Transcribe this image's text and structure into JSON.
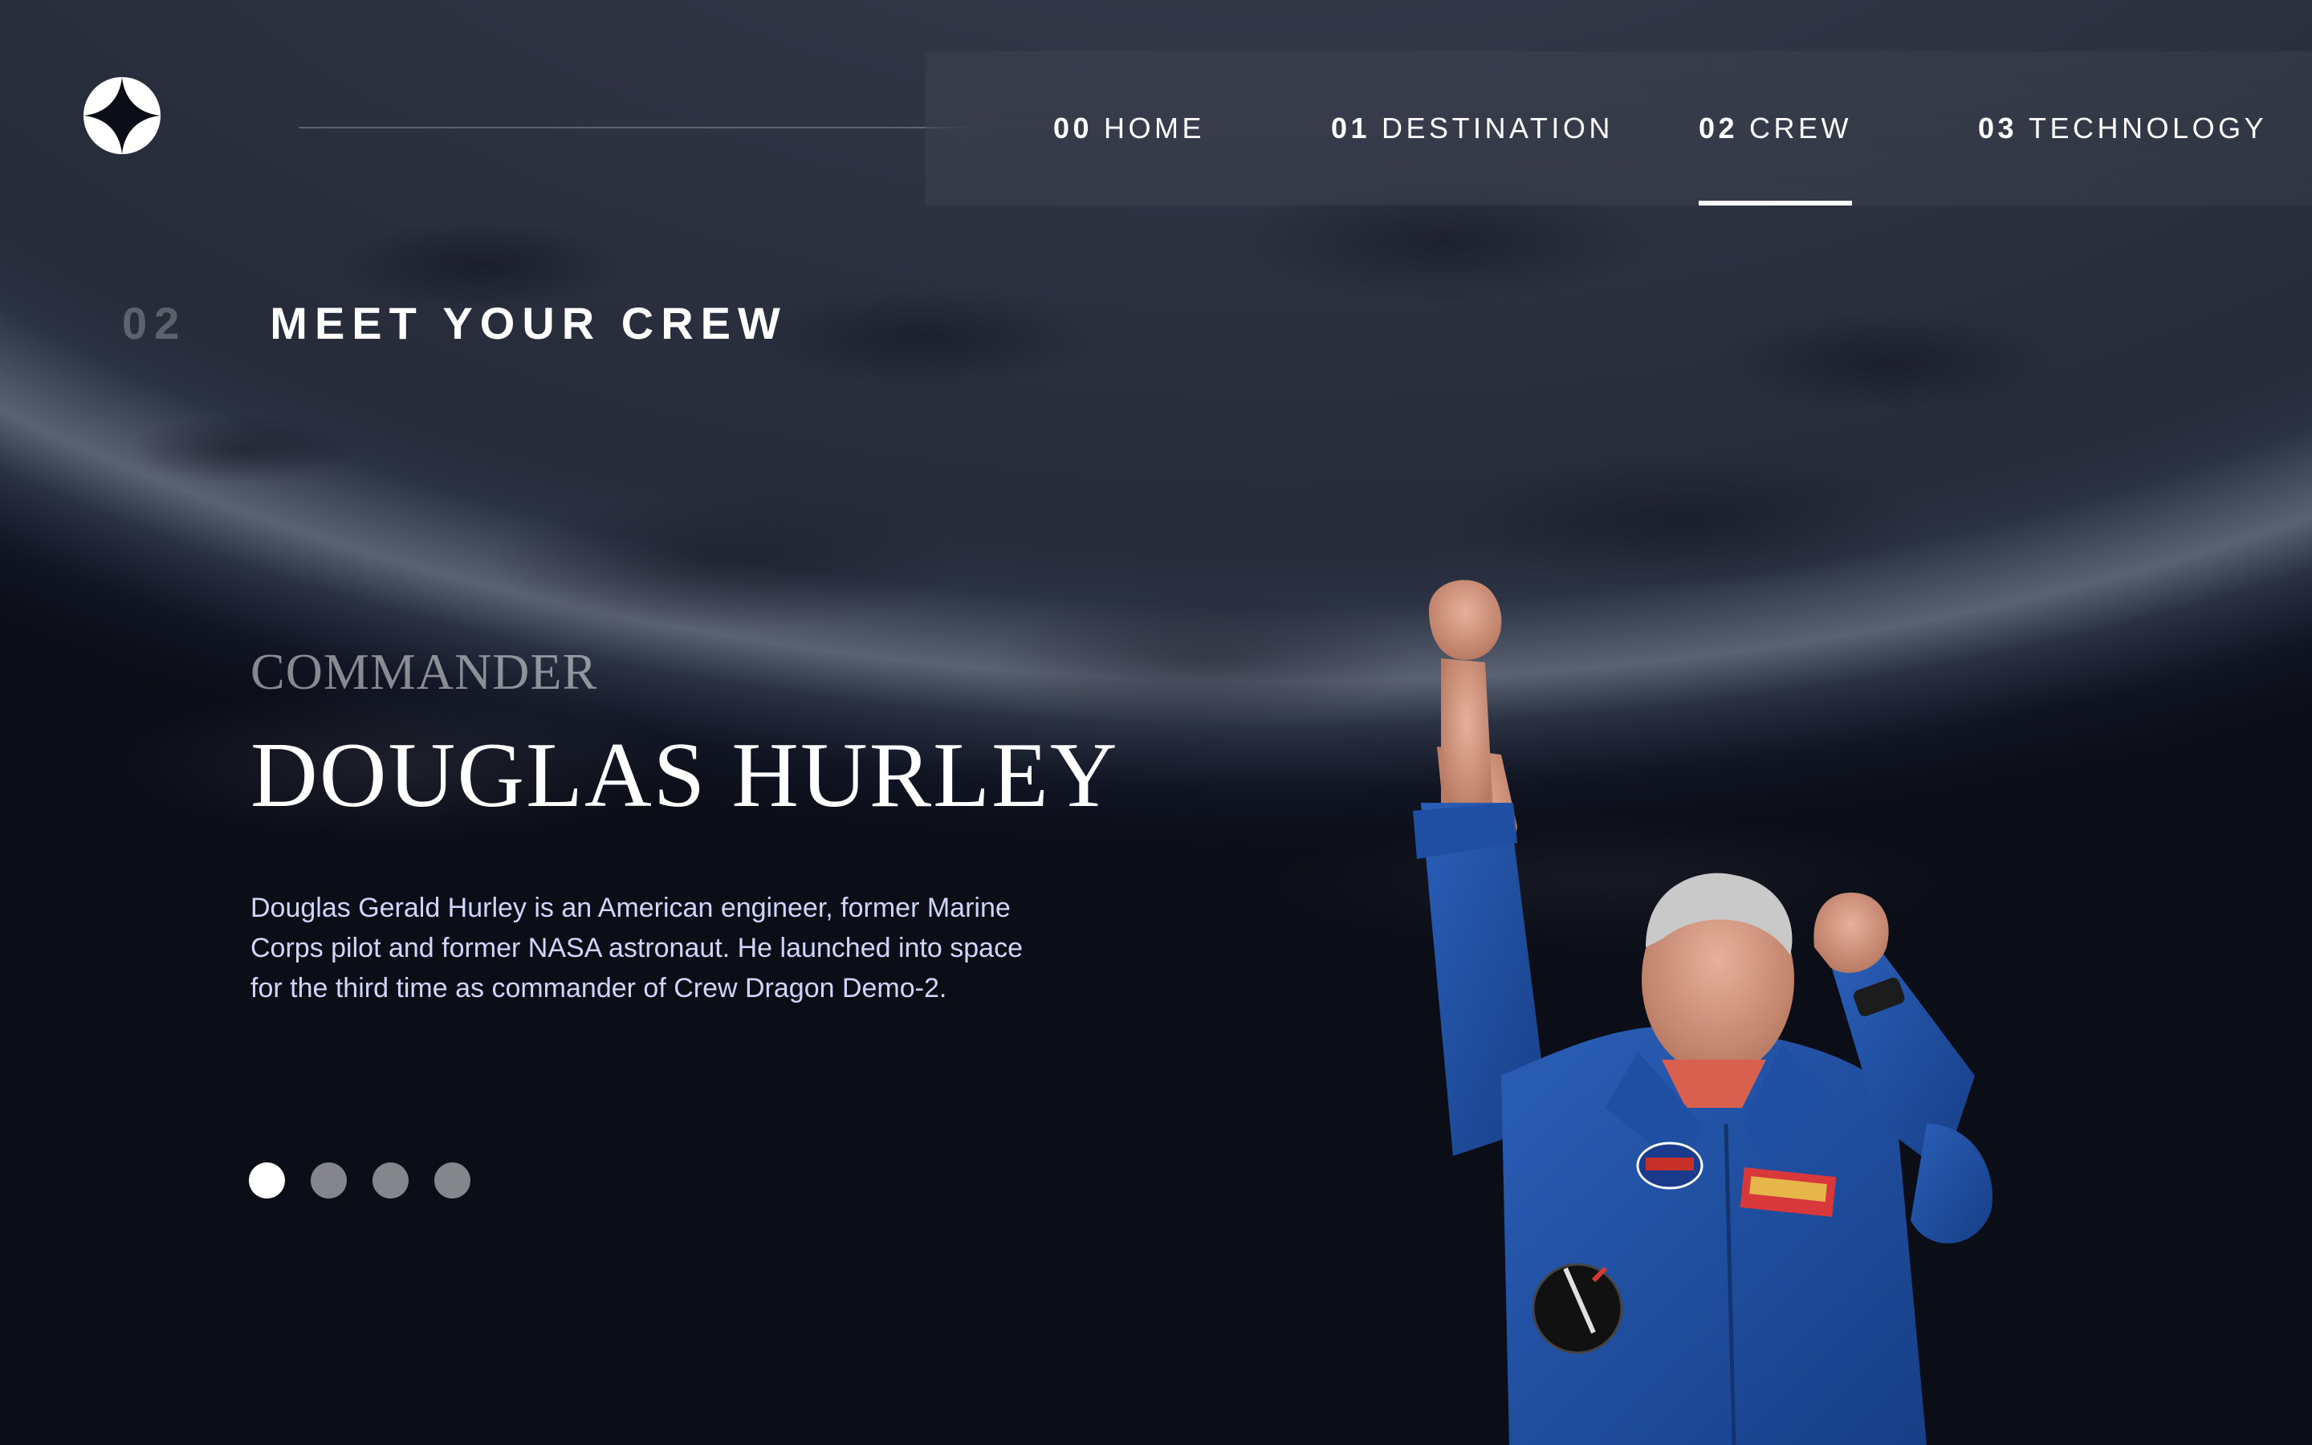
{
  "header": {
    "logo_icon": "star-icon",
    "nav": [
      {
        "num": "00",
        "label": "HOME",
        "active": false
      },
      {
        "num": "01",
        "label": "DESTINATION",
        "active": false
      },
      {
        "num": "02",
        "label": "CREW",
        "active": true
      },
      {
        "num": "03",
        "label": "TECHNOLOGY",
        "active": false
      }
    ]
  },
  "section": {
    "num": "02",
    "title": "MEET YOUR CREW"
  },
  "crew": {
    "role": "Commander",
    "name": "Douglas Hurley",
    "bio": "Douglas Gerald Hurley is an American engineer, former Marine Corps pilot and former NASA astronaut. He launched into space for the third time as commander of Crew Dragon Demo-2.",
    "slides_total": 4,
    "active_slide": 1
  },
  "colors": {
    "background": "#0b0d17",
    "accent_text": "#d0d6f9",
    "white": "#ffffff"
  }
}
